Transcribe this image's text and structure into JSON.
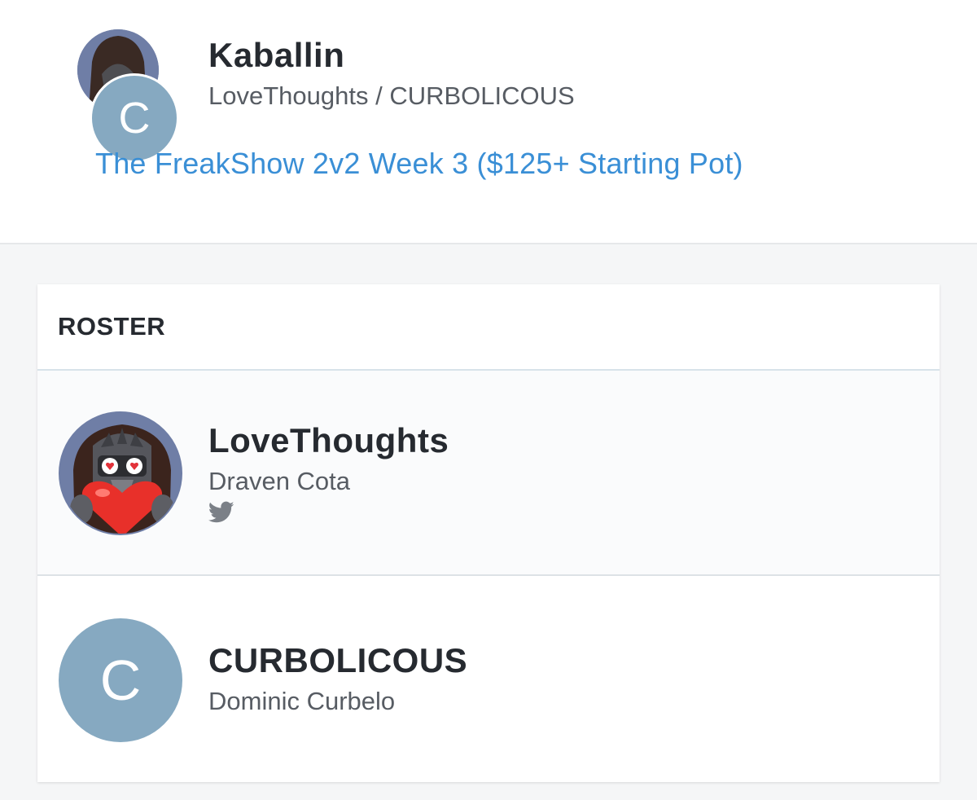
{
  "team": {
    "name": "Kaballin",
    "members": "LoveThoughts / CURBOLICOUS",
    "avatar_initial": "C",
    "event": "The FreakShow 2v2 Week 3 ($125+ Starting Pot)"
  },
  "roster": {
    "title": "ROSTER",
    "players": [
      {
        "gamertag": "LoveThoughts",
        "real_name": "Draven Cota",
        "avatar": "heart-monster-avatar",
        "social": "twitter-icon"
      },
      {
        "gamertag": "CURBOLICOUS",
        "real_name": "Dominic Curbelo",
        "avatar_initial": "C"
      }
    ]
  },
  "colors": {
    "link": "#3a8fd6",
    "initial_avatar_bg": "#86a9c1",
    "page_bg": "#f5f6f7",
    "text_dark": "#262a30",
    "text_muted": "#575c63"
  }
}
